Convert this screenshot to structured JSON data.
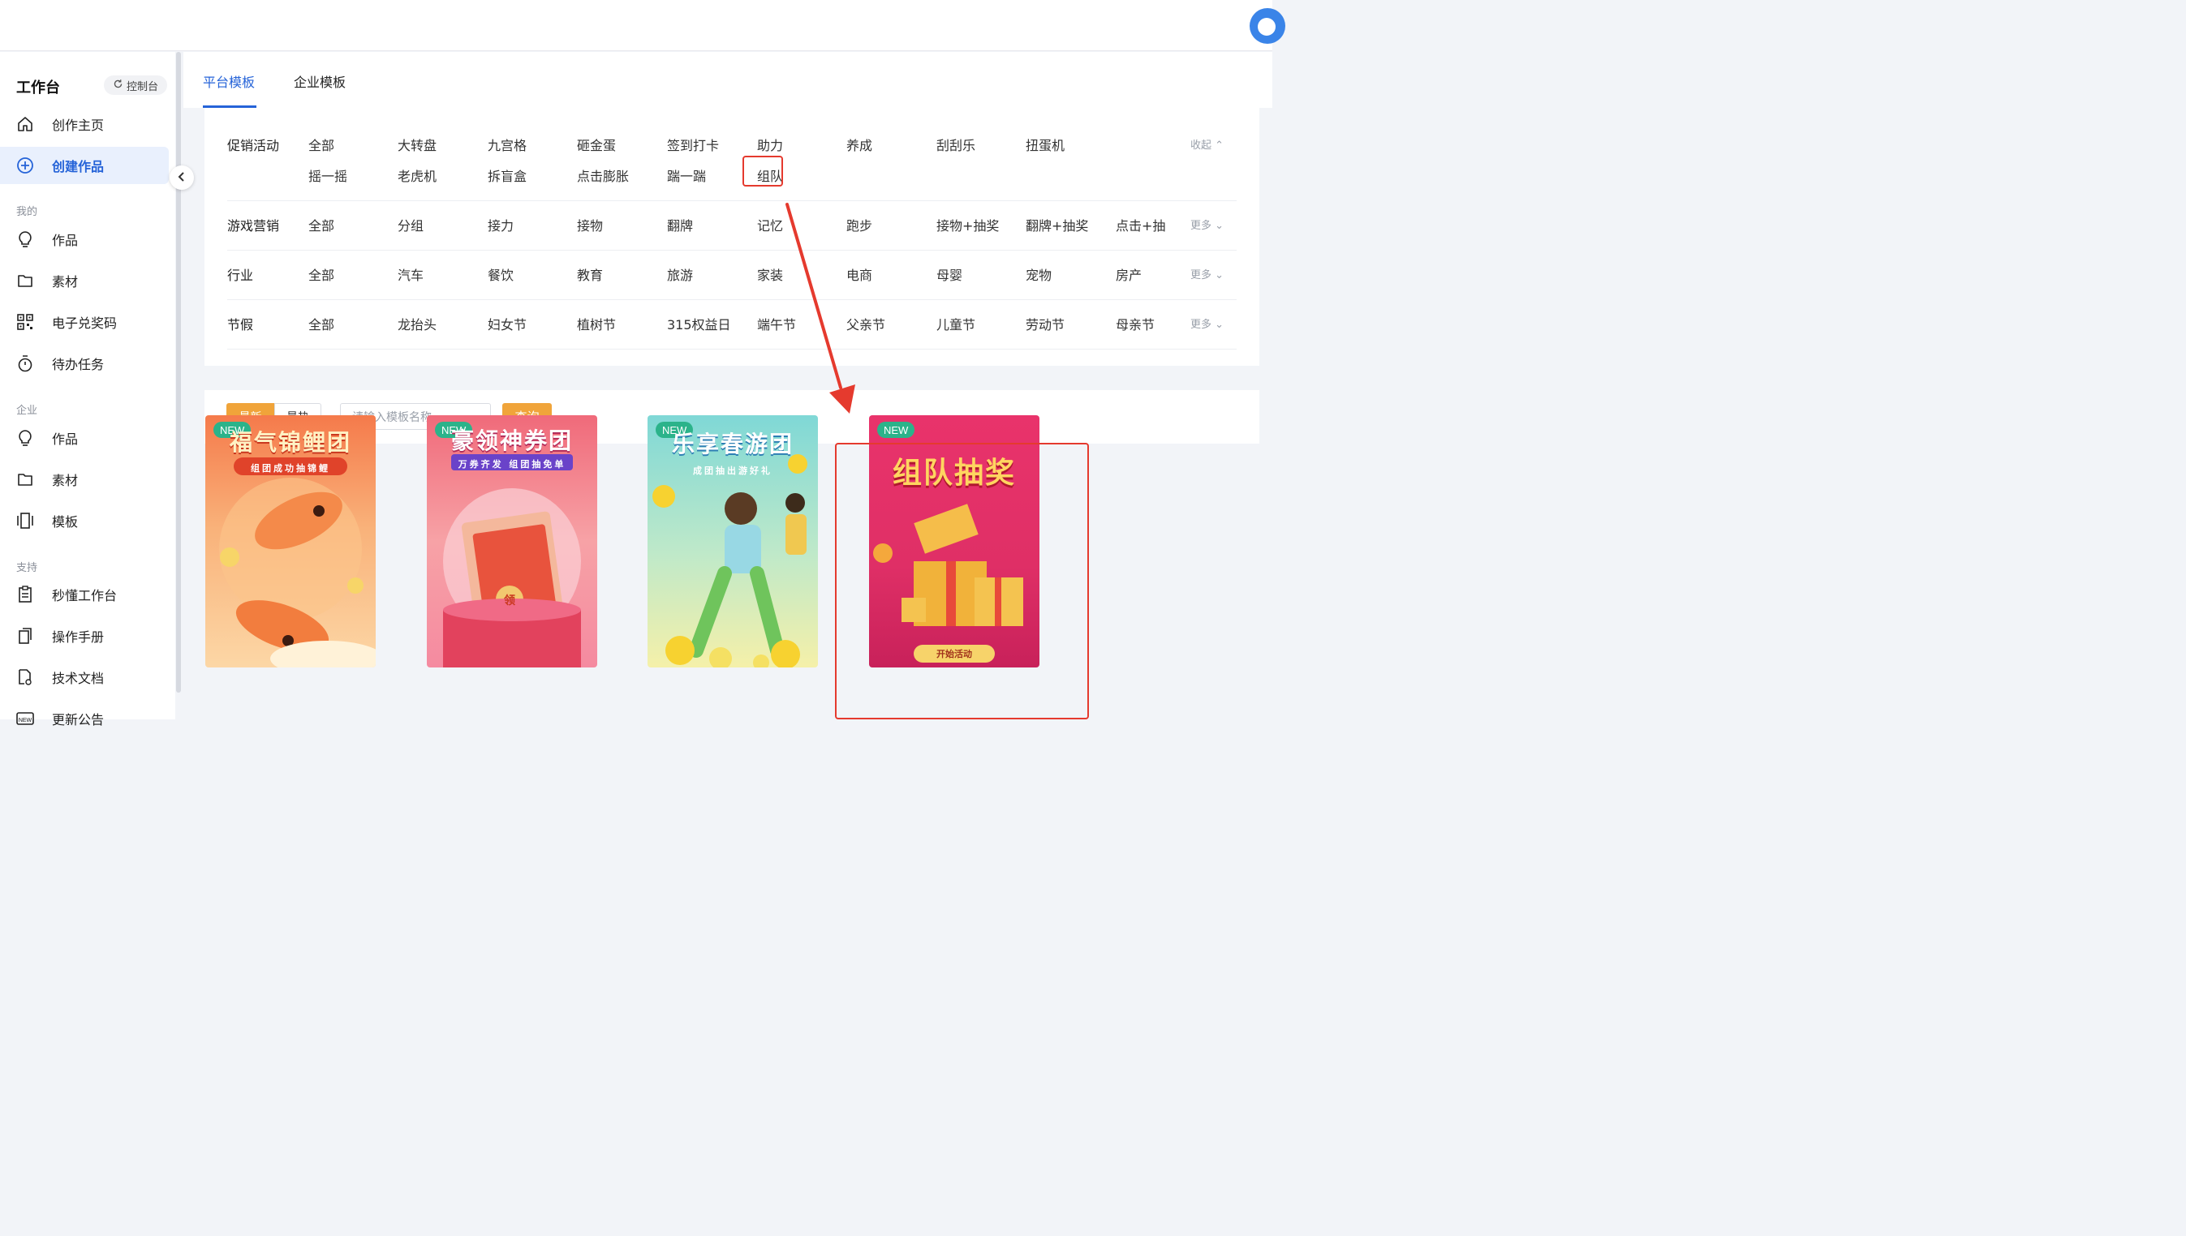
{
  "sidebar": {
    "title": "工作台",
    "console_label": "控制台",
    "items": [
      {
        "label": "创作主页",
        "icon": "home-icon"
      },
      {
        "label": "创建作品",
        "icon": "plus-circle-icon",
        "active": true
      }
    ],
    "groups": [
      {
        "title": "我的",
        "items": [
          {
            "label": "作品",
            "icon": "bulb-icon"
          },
          {
            "label": "素材",
            "icon": "folder-icon"
          },
          {
            "label": "电子兑奖码",
            "icon": "qrcode-icon"
          },
          {
            "label": "待办任务",
            "icon": "stopwatch-icon"
          }
        ]
      },
      {
        "title": "企业",
        "items": [
          {
            "label": "作品",
            "icon": "bulb-icon"
          },
          {
            "label": "素材",
            "icon": "folder-icon"
          },
          {
            "label": "模板",
            "icon": "template-icon"
          }
        ]
      },
      {
        "title": "支持",
        "items": [
          {
            "label": "秒懂工作台",
            "icon": "clipboard-icon"
          },
          {
            "label": "操作手册",
            "icon": "manual-icon"
          },
          {
            "label": "技术文档",
            "icon": "doc-icon"
          },
          {
            "label": "更新公告",
            "icon": "new-icon"
          }
        ]
      }
    ]
  },
  "tabs": [
    {
      "label": "平台模板",
      "active": true
    },
    {
      "label": "企业模板",
      "active": false
    }
  ],
  "filters": [
    {
      "label": "促销活动",
      "options": [
        "全部",
        "大转盘",
        "九宫格",
        "砸金蛋",
        "签到打卡",
        "助力",
        "养成",
        "刮刮乐",
        "扭蛋机"
      ],
      "options_row2": [
        "摇一摇",
        "老虎机",
        "拆盲盒",
        "点击膨胀",
        "踹一踹",
        "组队"
      ],
      "toggle": "收起 ⌃",
      "highlighted_option": "组队"
    },
    {
      "label": "游戏营销",
      "options": [
        "全部",
        "分组",
        "接力",
        "接物",
        "翻牌",
        "记忆",
        "跑步",
        "接物+抽奖",
        "翻牌+抽奖",
        "点击+抽奖"
      ],
      "toggle": "更多 ⌄"
    },
    {
      "label": "行业",
      "options": [
        "全部",
        "汽车",
        "餐饮",
        "教育",
        "旅游",
        "家装",
        "电商",
        "母婴",
        "宠物",
        "房产"
      ],
      "toggle": "更多 ⌄"
    },
    {
      "label": "节假",
      "options": [
        "全部",
        "龙抬头",
        "妇女节",
        "植树节",
        "315权益日",
        "端午节",
        "父亲节",
        "儿童节",
        "劳动节",
        "母亲节"
      ],
      "toggle": "更多 ⌄"
    }
  ],
  "search": {
    "sort_new": "最新",
    "sort_hot": "最热",
    "placeholder": "请输入模板名称",
    "query_label": "查询"
  },
  "cards": [
    {
      "badge": "NEW",
      "title": "福气锦鲤团",
      "subtitle": "组团成功抽锦鲤"
    },
    {
      "badge": "NEW",
      "title": "豪领神券团",
      "subtitle": "万券齐发 组团抽免单",
      "coupon_text": "领"
    },
    {
      "badge": "NEW",
      "title": "乐享春游团",
      "subtitle": "成团抽出游好礼"
    },
    {
      "badge": "NEW",
      "title": "组队抽奖",
      "button": "开始活动"
    }
  ],
  "colors": {
    "accent": "#2563d8",
    "orange": "#f0a43a",
    "annotation_red": "#e53a2e",
    "badge_green": "#2bb38a"
  }
}
